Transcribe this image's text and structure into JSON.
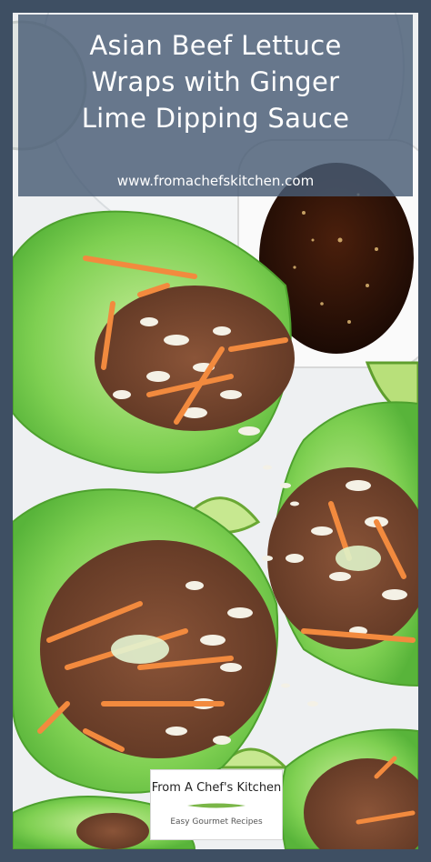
{
  "pin": {
    "title_lines": [
      "Asian Beef Lettuce",
      "Wraps with Ginger",
      "Lime Dipping Sauce"
    ],
    "website": "www.fromachefskitchen.com"
  },
  "logo": {
    "name": "From A Chef's Kitchen",
    "tagline": "Easy Gourmet Recipes"
  },
  "colors": {
    "frame": "#3e4f63",
    "banner": "#485c74",
    "lettuce": "#6cc24a",
    "beef": "#7a4a33",
    "carrot": "#f0823a",
    "sauce": "#2a130a"
  }
}
